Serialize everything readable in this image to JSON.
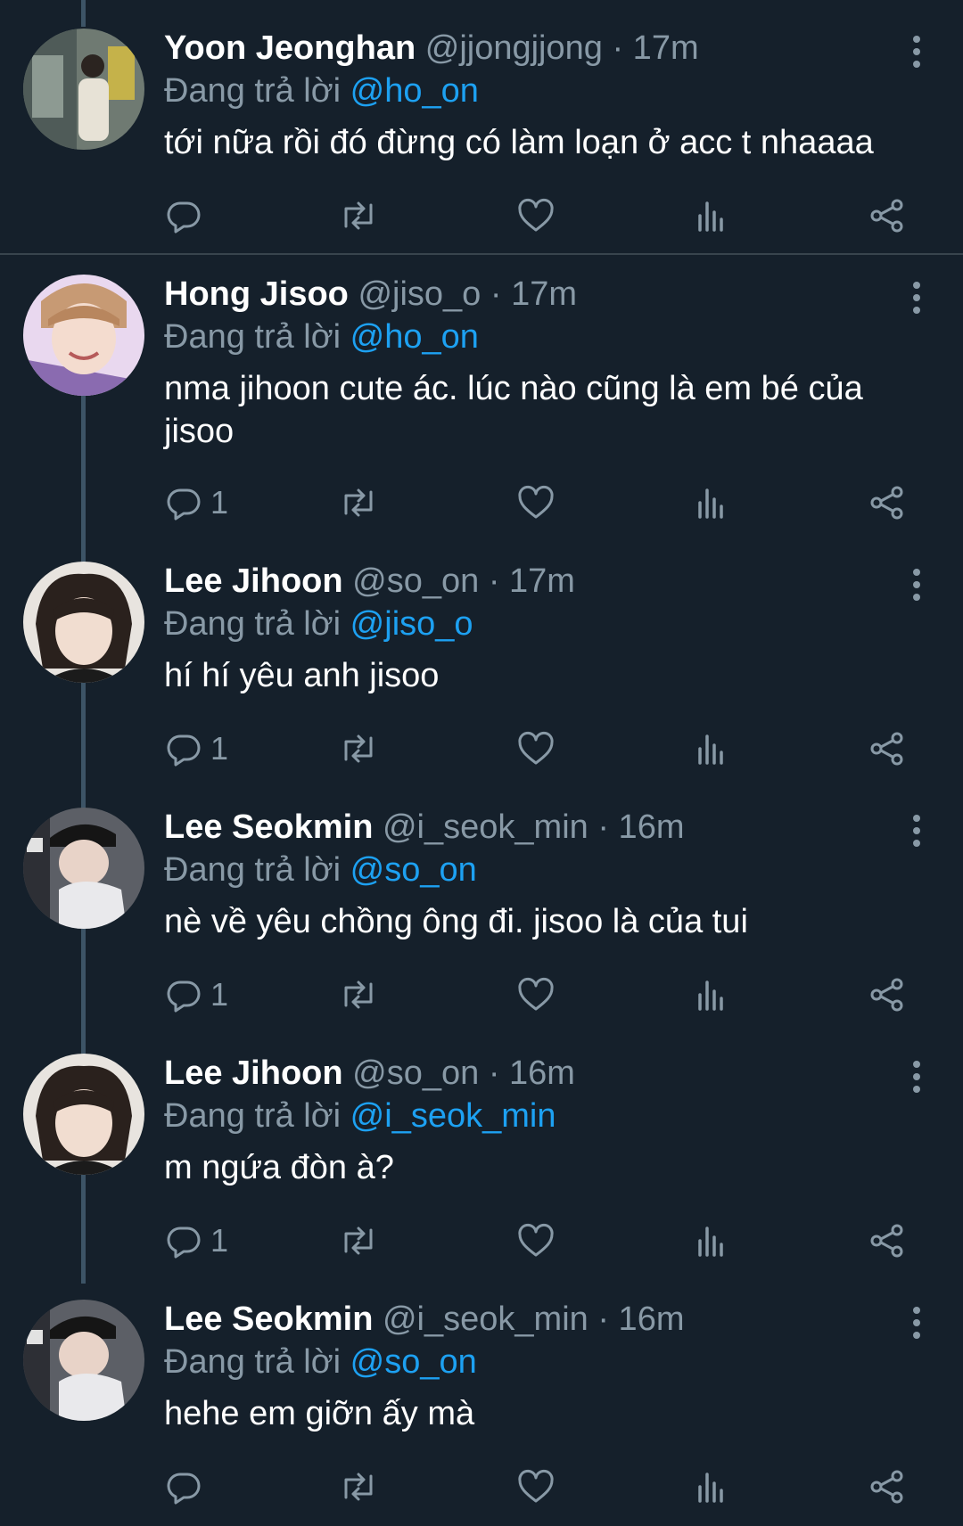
{
  "reply_prefix": "Đang trả lời",
  "colors": {
    "background": "#15202b",
    "muted": "#8899a6",
    "accent": "#1da1f2",
    "thread_line": "#3d5466"
  },
  "action_icons": [
    "reply-icon",
    "retweet-icon",
    "like-icon",
    "analytics-icon",
    "share-icon"
  ],
  "tweets": [
    {
      "name": "Yoon Jeonghan",
      "handle": "@jjongjjong",
      "time": "· 17m",
      "reply_to": "@ho_on",
      "text": "tới nữa rồi đó đừng có làm loạn ở acc t nhaaaa",
      "reply_count": ""
    },
    {
      "name": "Hong Jisoo",
      "handle": "@jiso_o",
      "time": "· 17m",
      "reply_to": "@ho_on",
      "text": "nma jihoon cute ác. lúc nào cũng là em bé của jisoo",
      "reply_count": "1"
    },
    {
      "name": "Lee Jihoon",
      "handle": "@so_on",
      "time": "· 17m",
      "reply_to": "@jiso_o",
      "text": "hí hí yêu anh jisoo",
      "reply_count": "1"
    },
    {
      "name": "Lee Seokmin",
      "handle": "@i_seok_min",
      "time": "· 16m",
      "reply_to": "@so_on",
      "text": "nè về yêu chồng ông đi. jisoo là của tui",
      "reply_count": "1"
    },
    {
      "name": "Lee Jihoon",
      "handle": "@so_on",
      "time": "· 16m",
      "reply_to": "@i_seok_min",
      "text": "m ngứa đòn à?",
      "reply_count": "1"
    },
    {
      "name": "Lee Seokmin",
      "handle": "@i_seok_min",
      "time": "· 16m",
      "reply_to": "@so_on",
      "text": "hehe em giỡn ấy mà",
      "reply_count": ""
    }
  ]
}
